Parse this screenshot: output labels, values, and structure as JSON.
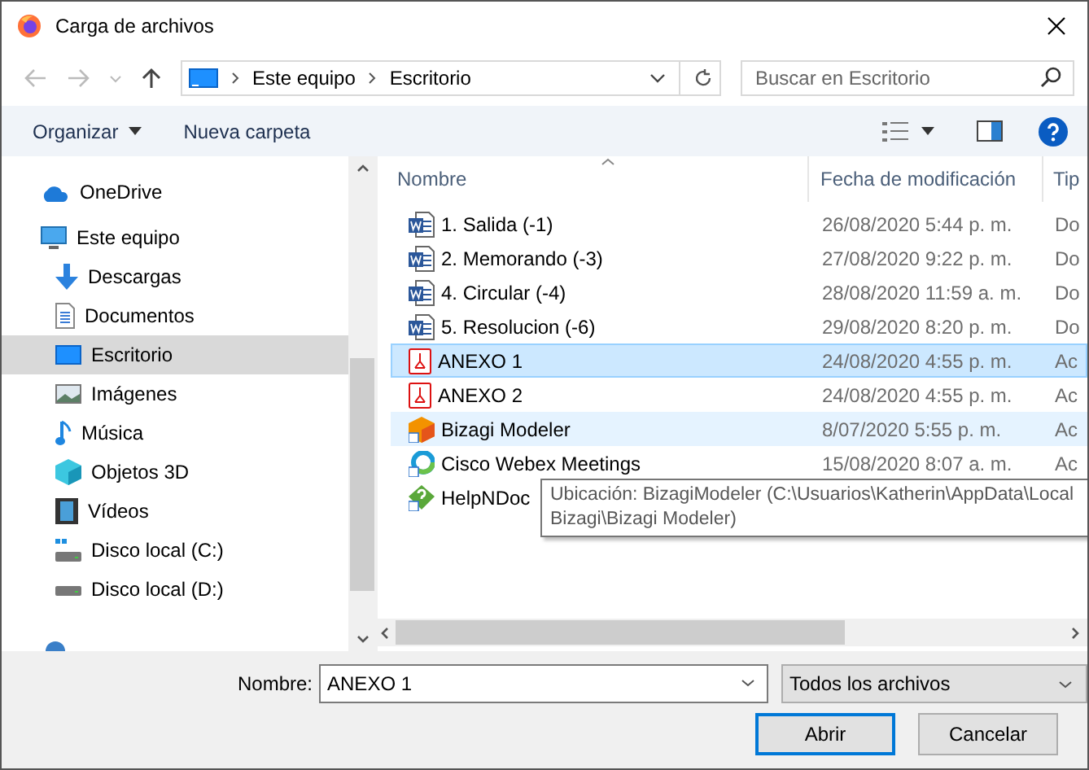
{
  "window": {
    "title": "Carga de archivos"
  },
  "breadcrumb": [
    "Este equipo",
    "Escritorio"
  ],
  "search": {
    "placeholder": "Buscar en Escritorio"
  },
  "toolbar": {
    "organize": "Organizar",
    "new_folder": "Nueva carpeta"
  },
  "sidebar": {
    "items": [
      {
        "label": "OneDrive",
        "selected": false
      },
      {
        "label": "Este equipo",
        "selected": false,
        "children": [
          {
            "label": "Descargas",
            "selected": false
          },
          {
            "label": "Documentos",
            "selected": false
          },
          {
            "label": "Escritorio",
            "selected": true
          },
          {
            "label": "Imágenes",
            "selected": false
          },
          {
            "label": "Música",
            "selected": false
          },
          {
            "label": "Objetos 3D",
            "selected": false
          },
          {
            "label": "Vídeos",
            "selected": false
          },
          {
            "label": "Disco local (C:)",
            "selected": false
          },
          {
            "label": "Disco local (D:)",
            "selected": false
          }
        ]
      }
    ]
  },
  "table": {
    "columns": [
      "Nombre",
      "Fecha de modificación",
      "Tip"
    ],
    "rows": [
      {
        "name": "1. Salida (-1)",
        "date": "26/08/2020 5:44 p. m.",
        "column_3": "Do",
        "kind": "word",
        "selected": false,
        "hovered": false
      },
      {
        "name": "2. Memorando (-3)",
        "date": "27/08/2020 9:22 p. m.",
        "column_3": "Do",
        "kind": "word",
        "selected": false,
        "hovered": false
      },
      {
        "name": "4. Circular (-4)",
        "date": "28/08/2020 11:59 a. m.",
        "column_3": "Do",
        "kind": "word",
        "selected": false,
        "hovered": false
      },
      {
        "name": "5. Resolucion (-6)",
        "date": "29/08/2020 8:20 p. m.",
        "column_3": "Do",
        "kind": "word",
        "selected": false,
        "hovered": false
      },
      {
        "name": "ANEXO 1",
        "date": "24/08/2020 4:55 p. m.",
        "column_3": "Ac",
        "kind": "pdf",
        "selected": true,
        "hovered": false
      },
      {
        "name": "ANEXO 2",
        "date": "24/08/2020 4:55 p. m.",
        "column_3": "Ac",
        "kind": "pdf",
        "selected": false,
        "hovered": false
      },
      {
        "name": "Bizagi Modeler",
        "date": "8/07/2020 5:55 p. m.",
        "column_3": "Ac",
        "kind": "bizagi",
        "selected": false,
        "hovered": true
      },
      {
        "name": "Cisco Webex Meetings",
        "date": "15/08/2020 8:07 a. m.",
        "column_3": "Ac",
        "kind": "webex",
        "selected": false,
        "hovered": false
      },
      {
        "name": "HelpNDoc",
        "kind": "help",
        "selected": false,
        "hovered": false
      }
    ]
  },
  "tooltip": [
    "Ubicación: BizagiModeler (C:\\Usuarios\\Katherin\\AppData\\Local",
    "Bizagi\\Bizagi Modeler)"
  ],
  "filename": {
    "label": "Nombre:",
    "value": "ANEXO 1"
  },
  "filter": {
    "value": "Todos los archivos"
  },
  "buttons": [
    {
      "label": "Abrir",
      "default": true
    },
    {
      "label": "Cancelar",
      "default": false
    }
  ]
}
